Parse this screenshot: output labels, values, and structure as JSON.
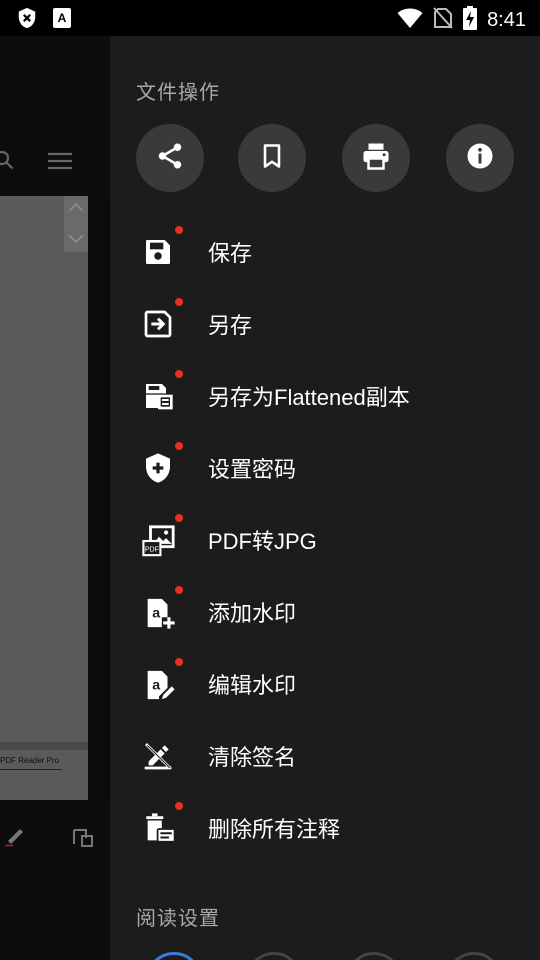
{
  "status_bar": {
    "time": "8:41",
    "left_icons": [
      "shield-x-icon",
      "a-box-icon"
    ],
    "right_icons": [
      "wifi-icon",
      "no-sim-icon",
      "battery-charging-icon"
    ]
  },
  "background_app": {
    "doc_footer_text": "PDF Reader Pro"
  },
  "drawer": {
    "file_ops_header": "文件操作",
    "quick_actions": [
      {
        "icon": "share-icon"
      },
      {
        "icon": "bookmark-icon"
      },
      {
        "icon": "print-icon"
      },
      {
        "icon": "info-icon"
      }
    ],
    "menu": [
      {
        "label": "保存",
        "icon": "save-icon",
        "dot": true
      },
      {
        "label": "另存",
        "icon": "save-as-icon",
        "dot": true
      },
      {
        "label": "另存为Flattened副本",
        "icon": "save-flattened-icon",
        "dot": true
      },
      {
        "label": "设置密码",
        "icon": "shield-plus-icon",
        "dot": true
      },
      {
        "label": "PDF转JPG",
        "icon": "pdf-to-image-icon",
        "dot": true
      },
      {
        "label": "添加水印",
        "icon": "add-watermark-icon",
        "dot": true
      },
      {
        "label": "编辑水印",
        "icon": "edit-watermark-icon",
        "dot": true
      },
      {
        "label": "清除签名",
        "icon": "clear-signature-icon",
        "dot": false
      },
      {
        "label": "删除所有注释",
        "icon": "delete-annotations-icon",
        "dot": true
      }
    ],
    "reading_header": "阅读设置"
  },
  "colors": {
    "drawer_bg": "#1c1c1c",
    "button_bg": "#3a3a3a",
    "badge_red": "#e53125",
    "header_gray": "#a8a8a8"
  }
}
